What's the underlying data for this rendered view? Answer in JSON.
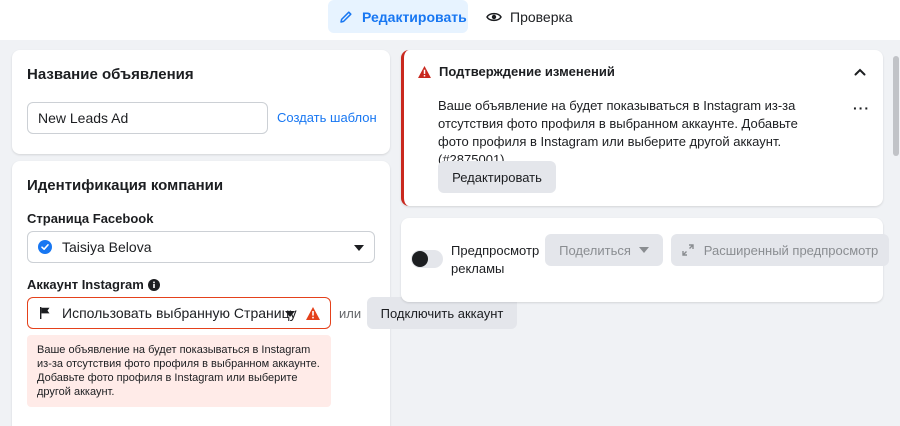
{
  "top_tabs": {
    "edit_label": "Редактировать",
    "preview_label": "Проверка"
  },
  "ad_name": {
    "title": "Название объявления",
    "value": "New Leads Ad",
    "template_link": "Создать шаблон"
  },
  "identity": {
    "title": "Идентификация компании",
    "facebook_page_label": "Страница Facebook",
    "facebook_page_value": "Taisiya Belova",
    "instagram_label": "Аккаунт Instagram",
    "instagram_select_value": "Использовать выбранную Страницу",
    "or_text": "или",
    "connect_button": "Подключить аккаунт",
    "error_text": "Ваше объявление на будет показываться в Instagram из-за отсутствия фото профиля в выбранном аккаунте. Добавьте фото профиля в Instagram или выберите другой аккаунт."
  },
  "confirm": {
    "title": "Подтверждение изменений",
    "message": "Ваше объявление на будет показываться в Instagram из-за отсутствия фото профиля в выбранном аккаунте. Добавьте фото профиля в Instagram или выберите другой аккаунт. (#2875001)",
    "edit_button": "Редактировать"
  },
  "preview": {
    "toggle_label": "Предпросмотр рекламы",
    "share_button": "Поделиться",
    "advanced_button": "Расширенный предпросмотр"
  },
  "colors": {
    "accent": "#1877f2",
    "error": "#e4411b",
    "warning": "#c9281e"
  }
}
